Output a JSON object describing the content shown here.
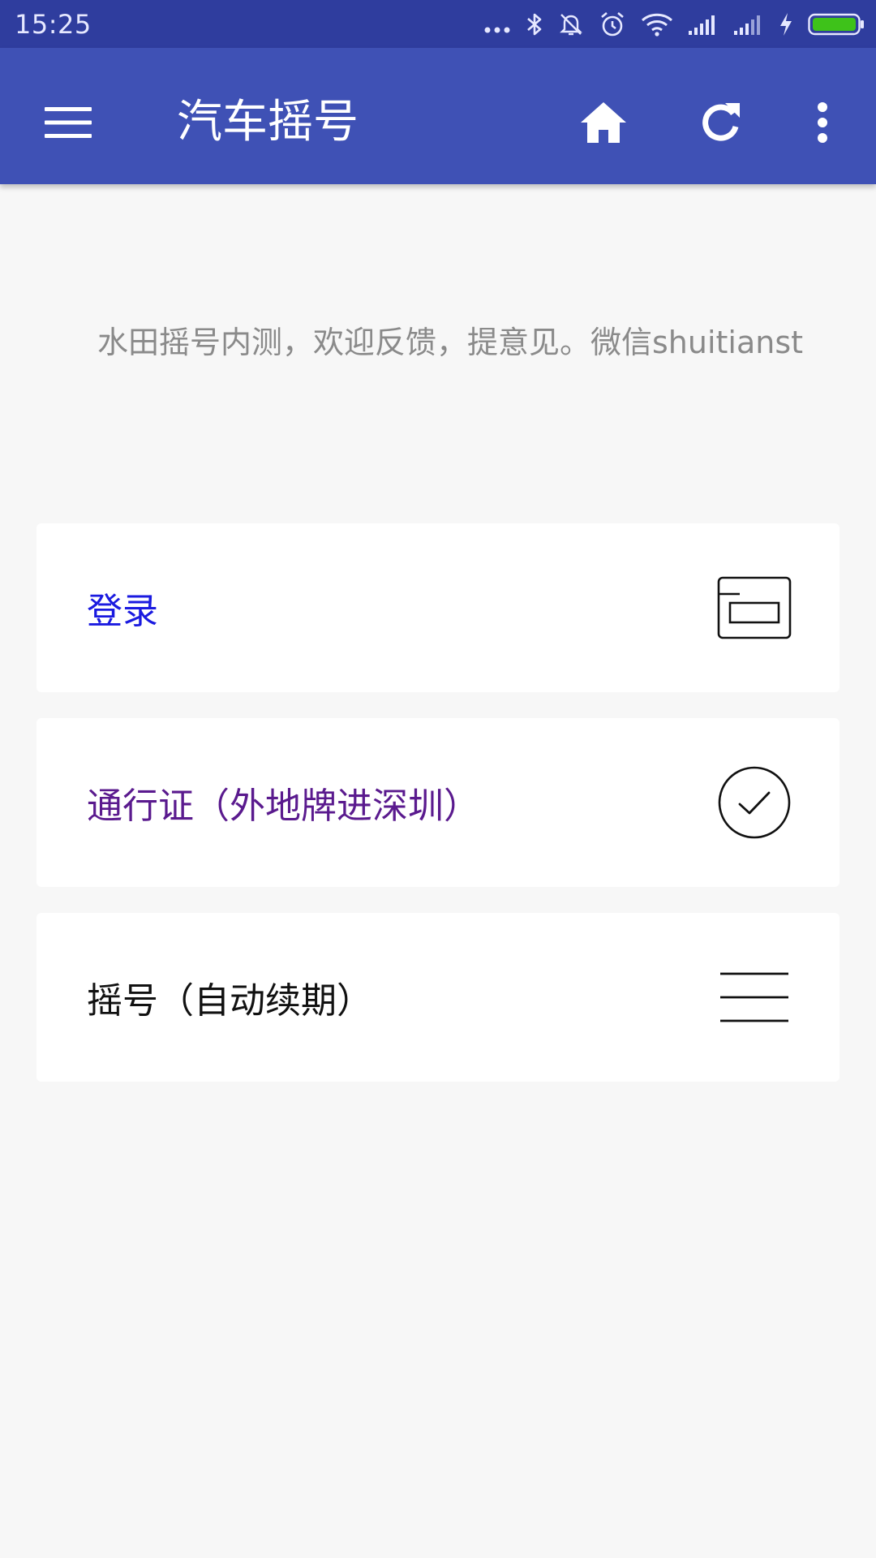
{
  "status_bar": {
    "time": "15:25",
    "icons": [
      "more-dots-icon",
      "bluetooth-icon",
      "notifications-off-icon",
      "alarm-icon",
      "wifi-icon",
      "signal-icon",
      "signal-icon",
      "charging-icon",
      "battery-icon"
    ],
    "battery_color": "#3ec21a"
  },
  "app_bar": {
    "title": "汽车摇号",
    "menu_icon": "menu-icon",
    "actions": [
      "home-icon",
      "refresh-icon",
      "more-vert-icon"
    ],
    "color": "#3f51b5"
  },
  "notice": {
    "text": "水田摇号内测，欢迎反馈，提意见。微信shuitianst"
  },
  "cards": [
    {
      "label": "登录",
      "icon": "card-icon",
      "color": "#1a1ae0"
    },
    {
      "label": "通行证（外地牌进深圳）",
      "icon": "check-circle-icon",
      "color": "#5a1a8e"
    },
    {
      "label": "摇号（自动续期）",
      "icon": "list-lines-icon",
      "color": "#111111"
    }
  ]
}
